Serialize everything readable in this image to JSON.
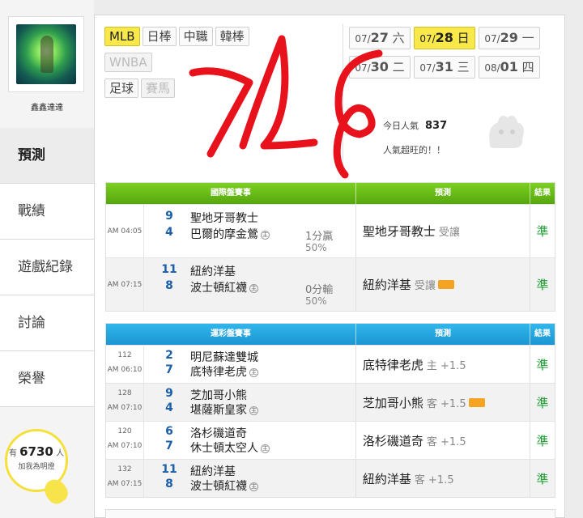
{
  "user": {
    "name": "鑫鑫達達"
  },
  "nav": [
    "預測",
    "戰績",
    "遊戲紀錄",
    "討論",
    "榮譽"
  ],
  "fans": {
    "prefix": "有",
    "count": "6730",
    "suffix": "人",
    "line2": "加我為明燈"
  },
  "sports": [
    {
      "label": "MLB",
      "state": "active"
    },
    {
      "label": "日棒",
      "state": "normal"
    },
    {
      "label": "中職",
      "state": "normal"
    },
    {
      "label": "韓棒",
      "state": "normal"
    },
    {
      "label": "WNBA",
      "state": "disabled"
    },
    {
      "label": "足球",
      "state": "normal"
    },
    {
      "label": "賽馬",
      "state": "disabled"
    }
  ],
  "dates": [
    {
      "month": "07/",
      "day": "27",
      "weekday": " 六",
      "active": false
    },
    {
      "month": "07/",
      "day": "28",
      "weekday": " 日",
      "active": true
    },
    {
      "month": "07/",
      "day": "29",
      "weekday": " 一",
      "active": false
    },
    {
      "month": "07/",
      "day": "30",
      "weekday": " 二",
      "active": false
    },
    {
      "month": "07/",
      "day": "31",
      "weekday": " 三",
      "active": false
    },
    {
      "month": "08/",
      "day": "01",
      "weekday": " 四",
      "active": false
    }
  ],
  "popularity": {
    "label": "今日人氣",
    "value": "837",
    "message": "人氣超旺的！！"
  },
  "intl_table": {
    "headers": [
      "國際盤賽事",
      "預測",
      "結果"
    ],
    "rows": [
      {
        "time": "AM 04:05",
        "away_score": "9",
        "away": "聖地牙哥教士",
        "home_score": "4",
        "home": "巴爾的摩金鶯",
        "host_mark": "主",
        "spread": "1分贏",
        "pct": "50%",
        "pick": "聖地牙哥教士",
        "pick_sub": "受讓",
        "badge": false,
        "result": "準"
      },
      {
        "time": "AM 07:15",
        "away_score": "11",
        "away": "紐約洋基",
        "home_score": "8",
        "home": "波士頓紅襪",
        "host_mark": "主",
        "spread": "0分輸",
        "pct": "50%",
        "pick": "紐約洋基",
        "pick_sub": "受讓",
        "badge": true,
        "result": "準"
      }
    ]
  },
  "lottery_table": {
    "headers": [
      "運彩盤賽事",
      "預測",
      "結果"
    ],
    "rows": [
      {
        "code": "112",
        "time": "AM 06:10",
        "away_score": "2",
        "away": "明尼蘇達雙城",
        "home_score": "7",
        "home": "底特律老虎",
        "host_mark": "主",
        "pick": "底特律老虎",
        "pick_sub": "主 +1.5",
        "badge": false,
        "result": "準"
      },
      {
        "code": "128",
        "time": "AM 07:10",
        "away_score": "9",
        "away": "芝加哥小熊",
        "home_score": "4",
        "home": "堪薩斯皇家",
        "host_mark": "主",
        "pick": "芝加哥小熊",
        "pick_sub": "客 +1.5",
        "badge": true,
        "result": "準"
      },
      {
        "code": "120",
        "time": "AM 07:10",
        "away_score": "6",
        "away": "洛杉磯道奇",
        "home_score": "7",
        "home": "休士頓太空人",
        "host_mark": "主",
        "pick": "洛杉磯道奇",
        "pick_sub": "客 +1.5",
        "badge": false,
        "result": "準"
      },
      {
        "code": "132",
        "time": "AM 07:15",
        "away_score": "11",
        "away": "紐約洋基",
        "home_score": "8",
        "home": "波士頓紅襪",
        "host_mark": "主",
        "pick": "紐約洋基",
        "pick_sub": "客 +1.5",
        "badge": false,
        "result": "準"
      }
    ]
  },
  "colors": {
    "accent_yellow": "#f9e84a",
    "green_header": "#56a70e",
    "blue_header": "#1c95d2",
    "result_green": "#1a9b2e",
    "scribble_red": "#e8121c"
  }
}
